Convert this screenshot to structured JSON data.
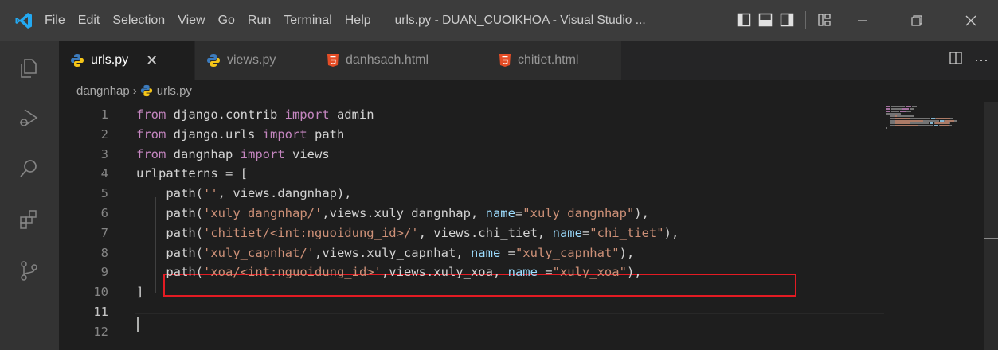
{
  "menu": [
    "File",
    "Edit",
    "Selection",
    "View",
    "Go",
    "Run",
    "Terminal",
    "Help"
  ],
  "window_title": "urls.py - DUAN_CUOIKHOA - Visual Studio ...",
  "tabs": [
    {
      "label": "urls.py",
      "icon": "python-icon",
      "active": true
    },
    {
      "label": "views.py",
      "icon": "python-icon",
      "active": false
    },
    {
      "label": "danhsach.html",
      "icon": "html-icon",
      "active": false
    },
    {
      "label": "chitiet.html",
      "icon": "html-icon",
      "active": false
    }
  ],
  "breadcrumb": {
    "folder": "dangnhap",
    "file": "urls.py"
  },
  "line_numbers": [
    "1",
    "2",
    "3",
    "4",
    "5",
    "6",
    "7",
    "8",
    "9",
    "10",
    "11",
    "12"
  ],
  "current_line": "11",
  "colors": {
    "keyword": "#c586c0",
    "string": "#ce9178",
    "parameter": "#9cdcfe",
    "text": "#d4d4d4",
    "highlight_border": "#e31b23"
  },
  "code_lines": [
    [
      {
        "t": "kw",
        "s": "from"
      },
      {
        "t": "plain",
        "s": " django.contrib "
      },
      {
        "t": "kw",
        "s": "import"
      },
      {
        "t": "plain",
        "s": " admin"
      }
    ],
    [
      {
        "t": "kw",
        "s": "from"
      },
      {
        "t": "plain",
        "s": " django.urls "
      },
      {
        "t": "kw",
        "s": "import"
      },
      {
        "t": "plain",
        "s": " path"
      }
    ],
    [
      {
        "t": "kw",
        "s": "from"
      },
      {
        "t": "plain",
        "s": " dangnhap "
      },
      {
        "t": "kw",
        "s": "import"
      },
      {
        "t": "plain",
        "s": " views"
      }
    ],
    [
      {
        "t": "plain",
        "s": "urlpatterns = ["
      }
    ],
    [
      {
        "t": "plain",
        "s": "    path("
      },
      {
        "t": "str",
        "s": "''"
      },
      {
        "t": "plain",
        "s": ", views.dangnhap),"
      }
    ],
    [
      {
        "t": "plain",
        "s": "    path("
      },
      {
        "t": "str",
        "s": "'xuly_dangnhap/'"
      },
      {
        "t": "plain",
        "s": ",views.xuly_dangnhap, "
      },
      {
        "t": "param",
        "s": "name"
      },
      {
        "t": "plain",
        "s": "="
      },
      {
        "t": "str",
        "s": "\"xuly_dangnhap\""
      },
      {
        "t": "plain",
        "s": "),"
      }
    ],
    [
      {
        "t": "plain",
        "s": "    path("
      },
      {
        "t": "str",
        "s": "'chitiet/<int:nguoidung_id>/'"
      },
      {
        "t": "plain",
        "s": ", views.chi_tiet, "
      },
      {
        "t": "param",
        "s": "name"
      },
      {
        "t": "plain",
        "s": "="
      },
      {
        "t": "str",
        "s": "\"chi_tiet\""
      },
      {
        "t": "plain",
        "s": "),"
      }
    ],
    [
      {
        "t": "plain",
        "s": "    path("
      },
      {
        "t": "str",
        "s": "'xuly_capnhat/'"
      },
      {
        "t": "plain",
        "s": ",views.xuly_capnhat, "
      },
      {
        "t": "param",
        "s": "name"
      },
      {
        "t": "plain",
        "s": " ="
      },
      {
        "t": "str",
        "s": "\"xuly_capnhat\""
      },
      {
        "t": "plain",
        "s": "),"
      }
    ],
    [
      {
        "t": "plain",
        "s": "    path("
      },
      {
        "t": "str",
        "s": "'xoa/<int:nguoidung_id>'"
      },
      {
        "t": "plain",
        "s": ",views.xuly_xoa, "
      },
      {
        "t": "param",
        "s": "name"
      },
      {
        "t": "plain",
        "s": " ="
      },
      {
        "t": "str",
        "s": "\"xuly_xoa\""
      },
      {
        "t": "plain",
        "s": "),"
      }
    ],
    [
      {
        "t": "plain",
        "s": "]"
      }
    ],
    [],
    []
  ]
}
